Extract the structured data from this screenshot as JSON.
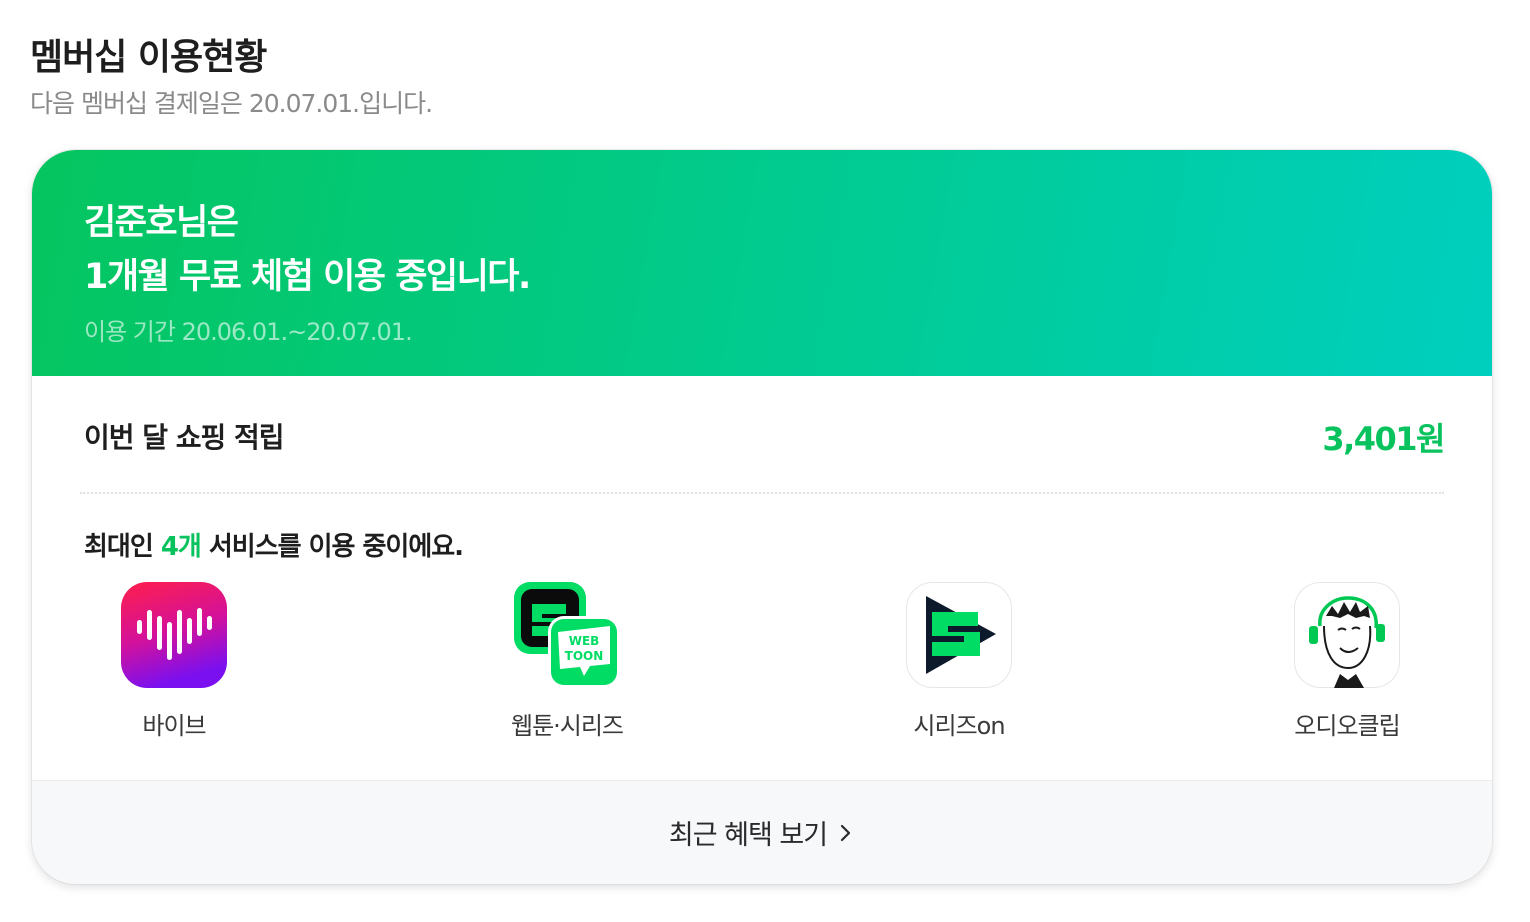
{
  "header": {
    "title": "멤버십 이용현황",
    "subtitle": "다음 멤버십 결제일은 20.07.01.입니다."
  },
  "hero": {
    "line1": "김준호님은",
    "line2": "1개월 무료 체험 이용 중입니다.",
    "period": "이용 기간 20.06.01.~20.07.01."
  },
  "points": {
    "label": "이번 달 쇼핑 적립",
    "value": "3,401원"
  },
  "services_summary": {
    "prefix": "최대인 ",
    "count": "4개",
    "suffix": " 서비스를 이용 중이에요."
  },
  "services": [
    {
      "label": "바이브",
      "icon": "vibe-icon"
    },
    {
      "label": "웹툰·시리즈",
      "icon": "webtoon-series-icon"
    },
    {
      "label": "시리즈on",
      "icon": "series-on-icon"
    },
    {
      "label": "오디오클립",
      "icon": "audioclip-icon"
    }
  ],
  "footer": {
    "benefits_label": "최근 혜택 보기"
  },
  "colors": {
    "accent_green": "#08c35d",
    "hero_gradient_start": "#05c55f",
    "hero_gradient_end": "#00cfbf",
    "vibe_gradient_top": "#ff1f4b",
    "vibe_gradient_bottom": "#7a10f0",
    "series_green": "#00dc64"
  }
}
